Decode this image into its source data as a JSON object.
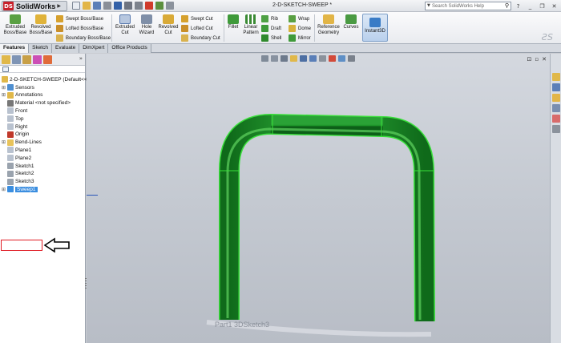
{
  "app": {
    "brand": "SolidWorks",
    "document_title": "2-D-SKETCH-SWEEP *",
    "search_placeholder": "Search SolidWorks Help"
  },
  "command_manager": {
    "features": [
      {
        "label": "Extruded\nBoss/Base",
        "icon": "extrude-boss-icon"
      },
      {
        "label": "Revolved\nBoss/Base",
        "icon": "revolve-boss-icon"
      }
    ],
    "small_features": [
      "Swept Boss/Base",
      "Lofted Boss/Base",
      "Boundary Boss/Base"
    ],
    "cut_features": [
      {
        "label": "Extruded\nCut",
        "icon": "extrude-cut-icon"
      },
      {
        "label": "Hole\nWizard",
        "icon": "hole-wizard-icon"
      },
      {
        "label": "Revolved\nCut",
        "icon": "revolve-cut-icon"
      }
    ],
    "small_cuts": [
      "Swept Cut",
      "Lofted Cut",
      "Boundary Cut"
    ],
    "modify_features": [
      {
        "label": "Fillet",
        "icon": "fillet-icon"
      },
      {
        "label": "Linear\nPattern",
        "icon": "linear-pattern-icon"
      }
    ],
    "small_modify": [
      "Rib",
      "Draft",
      "Shell"
    ],
    "small_modify2": [
      "Wrap",
      "Dome",
      "Mirror"
    ],
    "reference": [
      {
        "label": "Reference\nGeometry",
        "icon": "reference-geometry-icon"
      },
      {
        "label": "Curves",
        "icon": "curves-icon"
      }
    ],
    "instant3d": "Instant3D"
  },
  "tabs": [
    "Features",
    "Sketch",
    "Evaluate",
    "DimXpert",
    "Office Products"
  ],
  "feature_tree": {
    "root": "2-D-SKETCH-SWEEP  (Default<<",
    "items": [
      {
        "label": "Sensors",
        "icon": "sensors-icon",
        "expand": "plus"
      },
      {
        "label": "Annotations",
        "icon": "annotations-icon",
        "expand": "plus"
      },
      {
        "label": "Material <not specified>",
        "icon": "material-icon",
        "expand": ""
      },
      {
        "label": "Front",
        "icon": "plane-icon",
        "expand": ""
      },
      {
        "label": "Top",
        "icon": "plane-icon",
        "expand": ""
      },
      {
        "label": "Right",
        "icon": "plane-icon",
        "expand": ""
      },
      {
        "label": "Origin",
        "icon": "origin-icon",
        "expand": ""
      },
      {
        "label": "Bend-Lines",
        "icon": "folder-icon",
        "expand": "plus"
      },
      {
        "label": "Plane1",
        "icon": "plane-icon",
        "expand": ""
      },
      {
        "label": "Plane2",
        "icon": "plane-icon",
        "expand": ""
      },
      {
        "label": "Sketch1",
        "icon": "sketch-icon",
        "expand": ""
      },
      {
        "label": "Sketch2",
        "icon": "sketch-icon",
        "expand": ""
      },
      {
        "label": "Sketch3",
        "icon": "sketch-icon",
        "expand": ""
      },
      {
        "label": "Sweep1",
        "icon": "sweep-icon",
        "expand": "plus",
        "selected": true
      }
    ]
  },
  "viewport": {
    "watermark": "Part1 3DSketch3",
    "model_color": "#1f9a2b",
    "edge_color": "#39e03a"
  }
}
